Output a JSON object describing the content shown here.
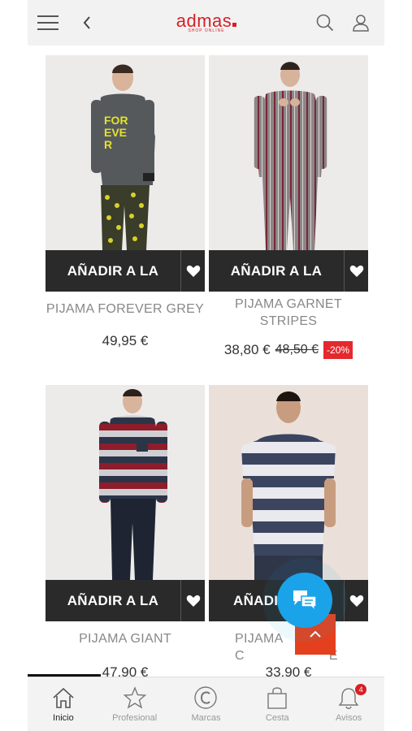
{
  "header": {
    "logo_text": "admas",
    "logo_tagline": "SHOP ONLINE",
    "menu_icon": "hamburger-menu-icon",
    "back_icon": "chevron-left-icon",
    "search_icon": "search-icon",
    "user_icon": "user-icon"
  },
  "colors": {
    "brand": "#d81f26",
    "discount": "#e4292e",
    "chat": "#1aa3e8",
    "scroll_top": "#e4401d"
  },
  "products": [
    {
      "add_label": "AÑADIR A LA",
      "name": "PIJAMA FOREVER GREY",
      "price": "49,95 €",
      "old_price": "",
      "discount": ""
    },
    {
      "add_label": "AÑADIR A LA",
      "name": "PIJAMA GARNET STRIPES",
      "price": "38,80 €",
      "old_price": "48,50 €",
      "discount": "-20%"
    },
    {
      "add_label": "AÑADIR A LA",
      "name": "PIJAMA GIANT",
      "price": "47,90 €",
      "old_price": "",
      "discount": ""
    },
    {
      "add_label": "AÑADIR A LA",
      "name": "PIJAMA C",
      "price": "33,90 €",
      "old_price": "",
      "discount": ""
    }
  ],
  "product_name_4_tail": "E",
  "tabbar": {
    "items": [
      {
        "label": "Inicio",
        "icon": "home-icon"
      },
      {
        "label": "Profesional",
        "icon": "star-icon"
      },
      {
        "label": "Marcas",
        "icon": "copyright-icon"
      },
      {
        "label": "Cesta",
        "icon": "shopping-bag-icon"
      },
      {
        "label": "Avisos",
        "icon": "bell-icon"
      }
    ],
    "notification_count": "4"
  }
}
